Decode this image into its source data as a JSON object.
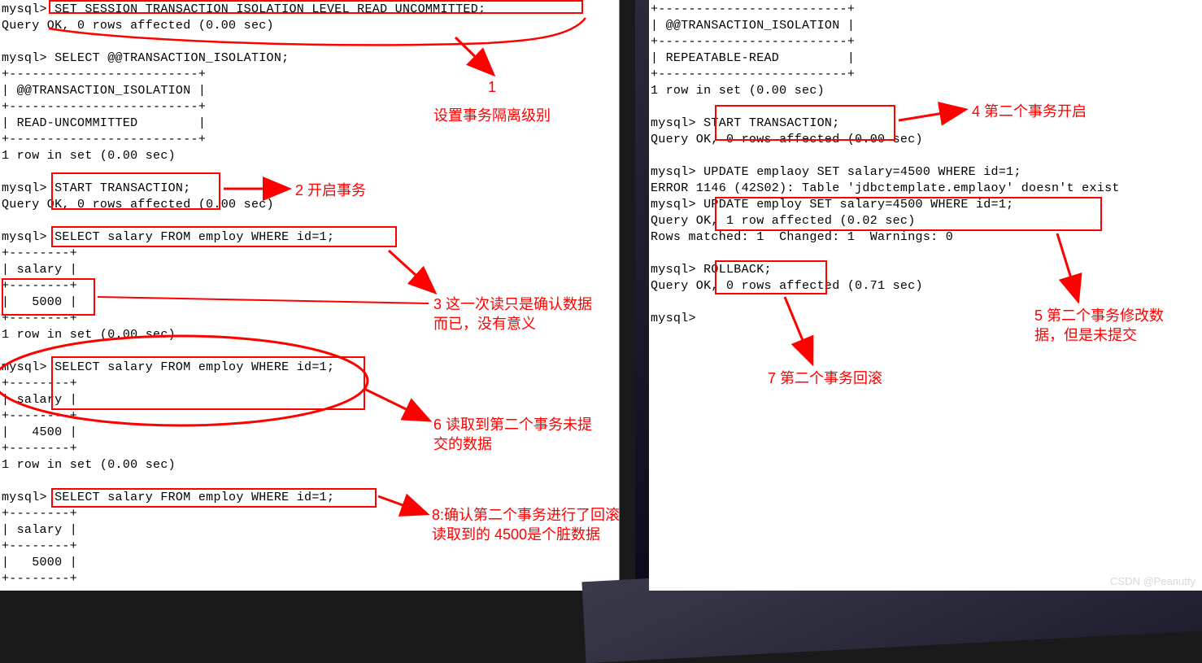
{
  "left_console": "mysql> SET SESSION TRANSACTION ISOLATION LEVEL READ UNCOMMITTED;\nQuery OK, 0 rows affected (0.00 sec)\n\nmysql> SELECT @@TRANSACTION_ISOLATION;\n+-------------------------+\n| @@TRANSACTION_ISOLATION |\n+-------------------------+\n| READ-UNCOMMITTED        |\n+-------------------------+\n1 row in set (0.00 sec)\n\nmysql> START TRANSACTION;\nQuery OK, 0 rows affected (0.00 sec)\n\nmysql> SELECT salary FROM employ WHERE id=1;\n+--------+\n| salary |\n+--------+\n|   5000 |\n+--------+\n1 row in set (0.00 sec)\n\nmysql> SELECT salary FROM employ WHERE id=1;\n+--------+\n| salary |\n+--------+\n|   4500 |\n+--------+\n1 row in set (0.00 sec)\n\nmysql> SELECT salary FROM employ WHERE id=1;\n+--------+\n| salary |\n+--------+\n|   5000 |\n+--------+",
  "right_console": "+-------------------------+\n| @@TRANSACTION_ISOLATION |\n+-------------------------+\n| REPEATABLE-READ         |\n+-------------------------+\n1 row in set (0.00 sec)\n\nmysql> START TRANSACTION;\nQuery OK, 0 rows affected (0.00 sec)\n\nmysql> UPDATE emplaoy SET salary=4500 WHERE id=1;\nERROR 1146 (42S02): Table 'jdbctemplate.emplaoy' doesn't exist\nmysql> UPDATE employ SET salary=4500 WHERE id=1;\nQuery OK, 1 row affected (0.02 sec)\nRows matched: 1  Changed: 1  Warnings: 0\n\nmysql> ROLLBACK;\nQuery OK, 0 rows affected (0.71 sec)\n\nmysql>",
  "labels": {
    "n1_num": "1",
    "n1_txt": "设置事务隔离级别",
    "n2": "2 开启事务",
    "n3": "3 这一次读只是确认数据而已，没有意义",
    "n4": "4 第二个事务开启",
    "n5": "5 第二个事务修改数据，但是未提交",
    "n6": "6 读取到第二个事务未提交的数据",
    "n7": "7 第二个事务回滚",
    "n8": "8:确认第二个事务进行了回滚\n读取到的 4500是个脏数据"
  },
  "watermark": "CSDN @Peanutty"
}
